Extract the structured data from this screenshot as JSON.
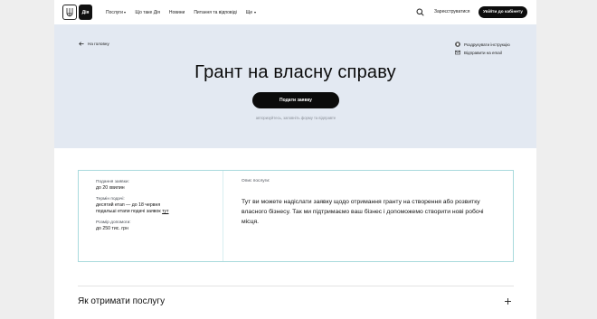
{
  "header": {
    "logo_text": "Дія",
    "nav": [
      {
        "label": "Послуги",
        "dropdown": true
      },
      {
        "label": "Що таке Дія",
        "dropdown": false
      },
      {
        "label": "Новини",
        "dropdown": false
      },
      {
        "label": "Питання та відповіді",
        "dropdown": false
      },
      {
        "label": "Ще",
        "dropdown": true
      }
    ],
    "search_icon": "search-icon",
    "register_label": "Зареєструватися",
    "login_label": "Увійти до кабінету"
  },
  "hero": {
    "back_label": "На головну",
    "print_label": "Роздрукувати інструкцію",
    "email_label": "Відправити на email",
    "title": "Грант на власну справу",
    "apply_label": "Подати заявку",
    "apply_note": "авторизуйтесь, заповніть форму та відправте"
  },
  "info": {
    "items": [
      {
        "label": "Подання заявки:",
        "value": "до 20 хвилин"
      },
      {
        "label": "Термін подачі:",
        "value": "десятий етап — до 18 червня",
        "value2": "подальші етапи подачі заявок",
        "link": "тут"
      },
      {
        "label": "Розмір допомоги:",
        "value": "до 250 тис. грн"
      }
    ],
    "description_label": "Опис послуги:",
    "description": "Тут ви можете надіслати заявку щодо отримання гранту на створення або розвитку власного бізнесу. Так ми підтримаємо ваш бізнес і допоможемо створити нові робочі місця."
  },
  "accordion": {
    "title": "Як отримати послугу"
  },
  "colors": {
    "hero_bg": "#e3e9f2",
    "accent_border": "#a9dadd",
    "button_bg": "#0b0b0b"
  }
}
